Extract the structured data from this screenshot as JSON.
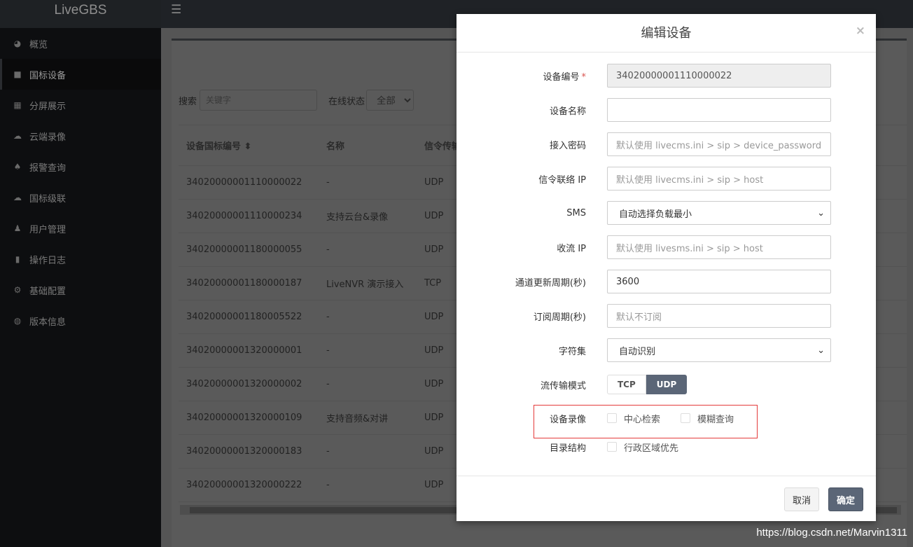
{
  "app": {
    "title": "LiveGBS"
  },
  "sidebar": {
    "items": [
      {
        "label": "概览",
        "icon": "dashboard-icon"
      },
      {
        "label": "国标设备",
        "icon": "video-camera-icon",
        "active": true
      },
      {
        "label": "分屏展示",
        "icon": "grid-icon"
      },
      {
        "label": "云端录像",
        "icon": "cloud-icon"
      },
      {
        "label": "报警查询",
        "icon": "bell-icon"
      },
      {
        "label": "国标级联",
        "icon": "cloud-upload-icon"
      },
      {
        "label": "用户管理",
        "icon": "users-icon"
      },
      {
        "label": "操作日志",
        "icon": "file-icon"
      },
      {
        "label": "基础配置",
        "icon": "gears-icon"
      },
      {
        "label": "版本信息",
        "icon": "globe-icon"
      }
    ]
  },
  "toolbar": {
    "search_label": "搜索",
    "search_placeholder": "关键字",
    "status_label": "在线状态",
    "status_value": "全部"
  },
  "table": {
    "headers": [
      "设备国标编号",
      "名称",
      "信令传输"
    ],
    "rows": [
      [
        "34020000001110000022",
        "-",
        "UDP"
      ],
      [
        "34020000001110000234",
        "支持云台&录像",
        "UDP"
      ],
      [
        "34020000001180000055",
        "-",
        "UDP"
      ],
      [
        "34020000001180000187",
        "LiveNVR 演示接入",
        "TCP"
      ],
      [
        "34020000001180005522",
        "-",
        "UDP"
      ],
      [
        "34020000001320000001",
        "-",
        "UDP"
      ],
      [
        "34020000001320000002",
        "-",
        "UDP"
      ],
      [
        "34020000001320000109",
        "支持音频&对讲",
        "UDP"
      ],
      [
        "34020000001320000183",
        "-",
        "UDP"
      ],
      [
        "34020000001320000222",
        "-",
        "UDP"
      ]
    ]
  },
  "modal": {
    "title": "编辑设备",
    "fields": {
      "device_id": {
        "label": "设备编号",
        "required": "*",
        "value": "34020000001110000022"
      },
      "device_name": {
        "label": "设备名称",
        "value": ""
      },
      "password": {
        "label": "接入密码",
        "placeholder": "默认使用 livecms.ini > sip > device_password"
      },
      "signal_ip": {
        "label": "信令联络 IP",
        "placeholder": "默认使用 livecms.ini > sip > host"
      },
      "sms": {
        "label": "SMS",
        "value": "自动选择负载最小"
      },
      "stream_ip": {
        "label": "收流 IP",
        "placeholder": "默认使用 livesms.ini > sip > host"
      },
      "channel_period": {
        "label": "通道更新周期(秒)",
        "value": "3600"
      },
      "subscribe_period": {
        "label": "订阅周期(秒)",
        "placeholder": "默认不订阅"
      },
      "charset": {
        "label": "字符集",
        "value": "自动识别"
      },
      "transport": {
        "label": "流传输模式",
        "options": [
          "TCP",
          "UDP"
        ],
        "selected": "UDP"
      },
      "record": {
        "label": "设备录像",
        "opt1": "中心检索",
        "opt2": "模糊查询"
      },
      "catalog": {
        "label": "目录结构",
        "opt1": "行政区域优先"
      }
    },
    "cancel": "取消",
    "ok": "确定"
  },
  "watermark": "https://blog.csdn.net/Marvin1311",
  "colors": {
    "accent": "#5b6677",
    "highlight_box": "#e43b3b"
  }
}
